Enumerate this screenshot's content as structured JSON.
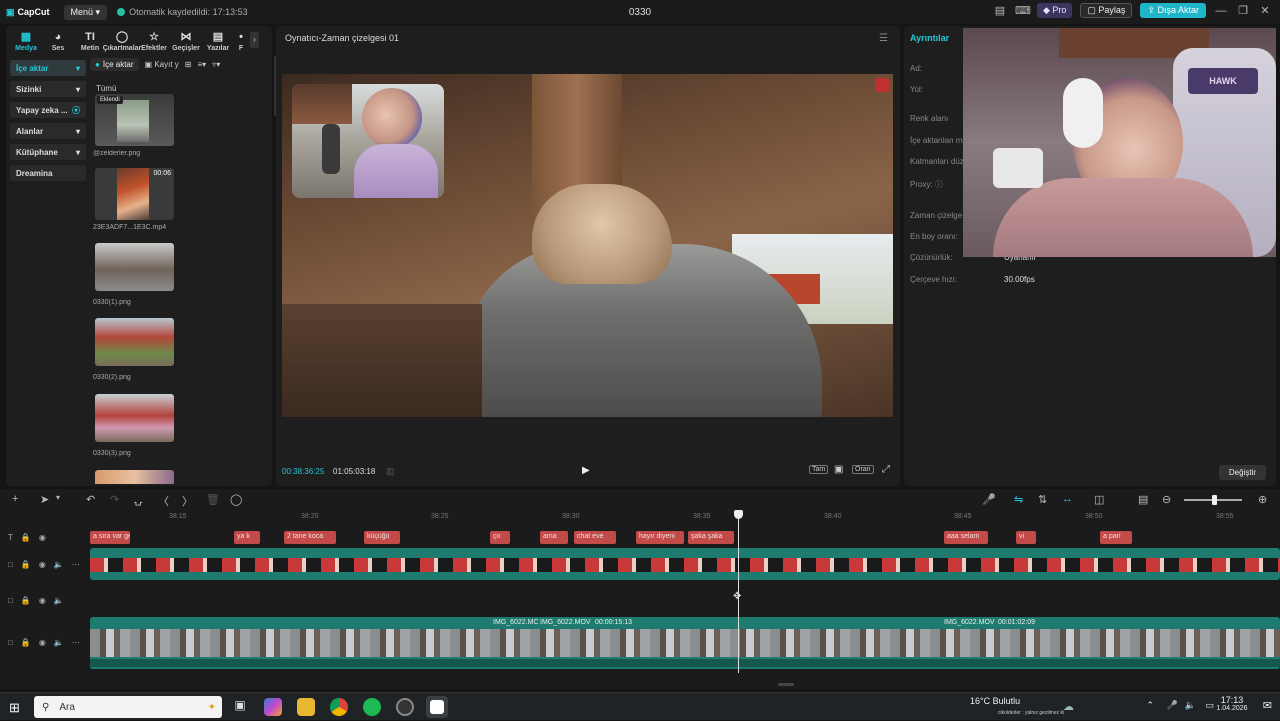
{
  "titlebar": {
    "app_name": "CapCut",
    "menu_label": "Menü",
    "autosave": "Otomatik kaydedildi: 17:13:53",
    "project_name": "0330",
    "pro_label": "Pro",
    "share_label": "Paylaş",
    "export_label": "Dışa Aktar"
  },
  "toolbar": {
    "tools": [
      {
        "label": "Medya",
        "icon": "media-icon"
      },
      {
        "label": "Ses",
        "icon": "audio-icon"
      },
      {
        "label": "Metin",
        "icon": "text-icon"
      },
      {
        "label": "Çıkartmalar",
        "icon": "sticker-icon"
      },
      {
        "label": "Efektler",
        "icon": "effects-icon"
      },
      {
        "label": "Geçişler",
        "icon": "transitions-icon"
      },
      {
        "label": "Yazılar",
        "icon": "captions-icon"
      },
      {
        "label": "F",
        "icon": "filters-icon"
      }
    ]
  },
  "sidebar": {
    "items": [
      {
        "label": "İçe aktar"
      },
      {
        "label": "Sizinki"
      },
      {
        "label": "Yapay zeka ..."
      },
      {
        "label": "Alanlar"
      },
      {
        "label": "Kütüphane"
      },
      {
        "label": "Dreamina"
      }
    ]
  },
  "media": {
    "import_label": "İçe aktar",
    "record_label": "Kayıt y",
    "filter_all": "Tümü",
    "items": [
      {
        "name": "@zelderler.png",
        "badge": "Eklendi"
      },
      {
        "name": "23E3ADF7...1E3C.mp4",
        "duration": "00:06"
      },
      {
        "name": "0330(1).png"
      },
      {
        "name": "0330(2).png"
      },
      {
        "name": "0330(3).png"
      }
    ]
  },
  "player": {
    "title": "Oynatıcı-Zaman çizelgesi 01",
    "current_time": "00:38:36:25",
    "total_time": "01:05:03:18",
    "full_label": "Tam",
    "ratio_label": "Oran"
  },
  "details": {
    "title": "Ayrıntılar",
    "rows": [
      {
        "label": "Ad:",
        "value": ""
      },
      {
        "label": "Yol:",
        "value": ""
      },
      {
        "label": "Renk alanı",
        "value": ""
      },
      {
        "label": "İçe aktarılan me",
        "value": ""
      },
      {
        "label": "Katmanları düz",
        "value": ""
      },
      {
        "label": "Proxy:",
        "value": ""
      },
      {
        "label": "Zaman çizelge",
        "value": ""
      },
      {
        "label": "En boy oranı:",
        "value": ""
      },
      {
        "label": "Çözünürlük:",
        "value": "Uyarlanır"
      },
      {
        "label": "Çerçeve hızı:",
        "value": "30.00fps"
      }
    ],
    "change_label": "Değiştir"
  },
  "timeline": {
    "ticks": [
      "38:15",
      "38:20",
      "38:25",
      "38:30",
      "38:35",
      "38:40",
      "38:45",
      "38:50",
      "38:55"
    ],
    "text_clips": [
      "a sıra var ge",
      "ya k",
      "2 tane koca",
      "küçüğü",
      "ço",
      "ama",
      "chat eve",
      "hayır diyeni",
      "şaka şaka",
      "aaa selam",
      "vi",
      "a pari"
    ],
    "video_labels": [
      "IMG_6022.MC",
      "IMG_6022.MOV",
      "00:00:15:13",
      "IMG_6022.MOV",
      "00:01:02:09"
    ]
  },
  "taskbar": {
    "search_placeholder": "Ara",
    "weather_temp": "16°C",
    "weather_desc": "Bulutlu",
    "weather_sub": "cikolderler : yalnız gezilmez ki",
    "time": "17:13",
    "date": "1.04.2026"
  },
  "colors": {
    "accent": "#22c7d6",
    "text_clip": "#c24a48",
    "sticker_track": "#1d7c6f",
    "export": "#1fb5c8"
  }
}
